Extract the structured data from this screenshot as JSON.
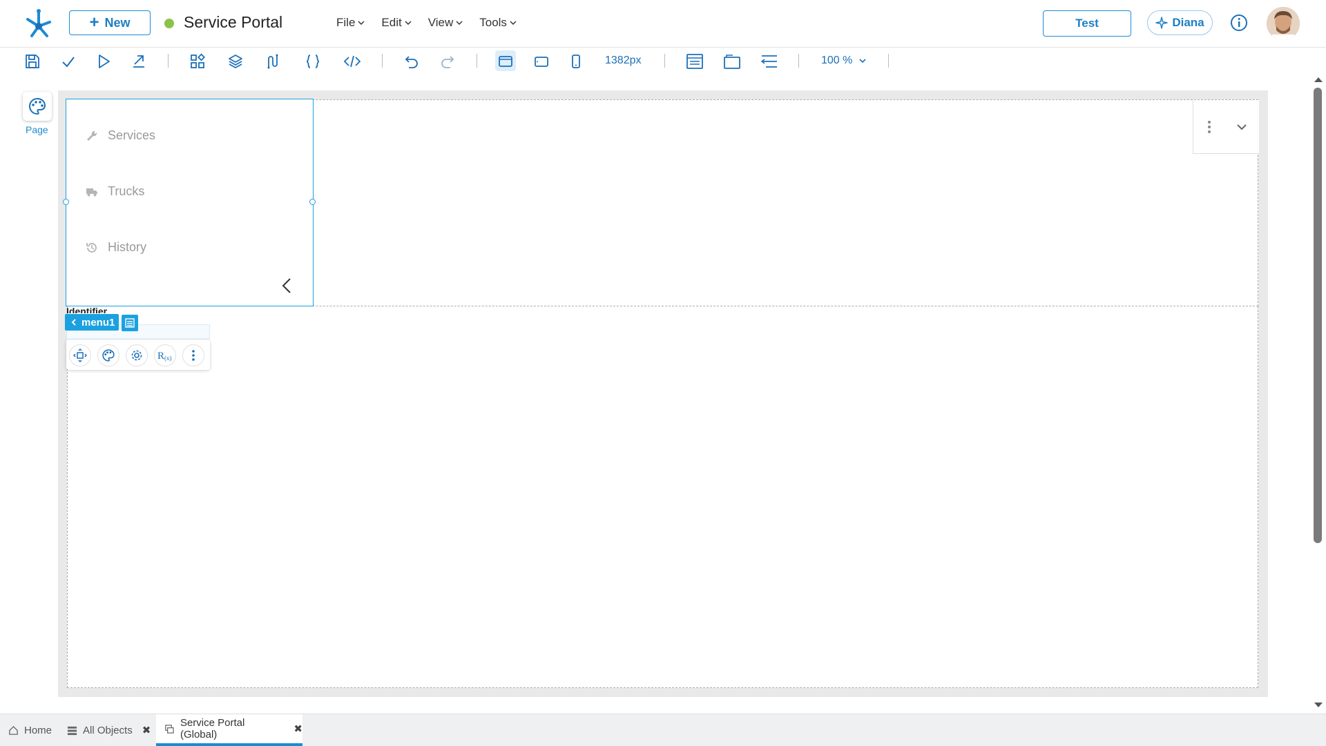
{
  "header": {
    "new_label": "New",
    "app_title": "Service Portal",
    "status_color": "#8bc34a",
    "menus": [
      "File",
      "Edit",
      "View",
      "Tools"
    ],
    "test_label": "Test",
    "assistant_label": "Diana"
  },
  "toolbar": {
    "width_value": "1382px",
    "zoom_value": "100 %"
  },
  "left_panel": {
    "page_label": "Page"
  },
  "menu_panel": {
    "items": [
      {
        "label": "Services",
        "icon": "wrench-icon"
      },
      {
        "label": "Trucks",
        "icon": "truck-icon"
      },
      {
        "label": "History",
        "icon": "history-icon"
      }
    ]
  },
  "selection": {
    "identifier_label": "Identifier",
    "control_name": "menu1"
  },
  "tabs": [
    {
      "label": "Home",
      "icon": "home-icon"
    },
    {
      "label": "All Objects",
      "icon": "list-icon"
    },
    {
      "label": "Service Portal (Global)",
      "icon": "panel-icon"
    }
  ],
  "colors": {
    "accent": "#1b8bd4",
    "selection": "#1ba1e0"
  }
}
